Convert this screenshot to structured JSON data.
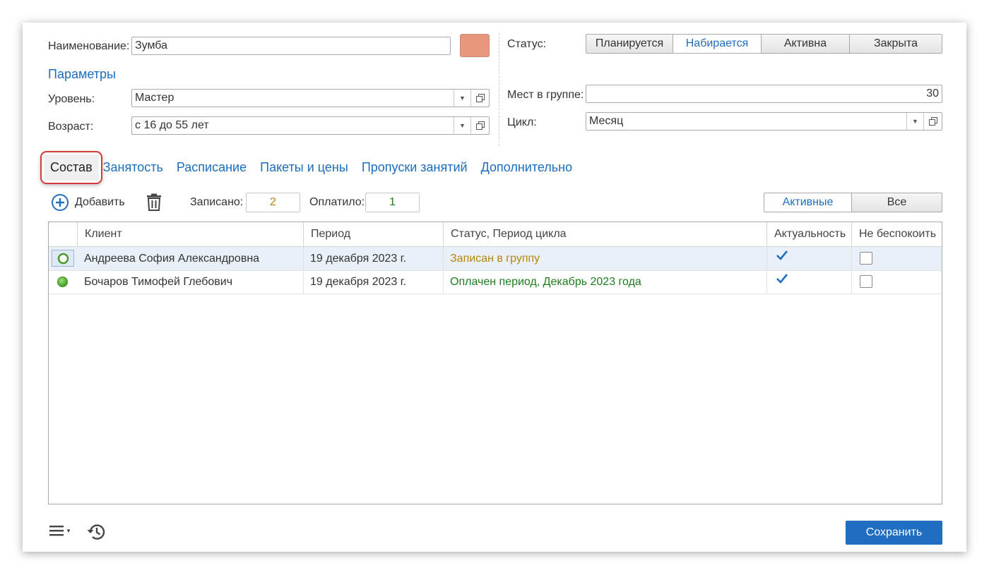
{
  "form": {
    "name_label": "Наименование:",
    "name_value": "Зумба",
    "color_swatch": "#e8967c",
    "params_title": "Параметры",
    "level_label": "Уровень:",
    "level_value": "Мастер",
    "age_label": "Возраст:",
    "age_value": "с 16 до 55 лет",
    "status_label": "Статус:",
    "status_options": [
      "Планируется",
      "Набирается",
      "Активна",
      "Закрыта"
    ],
    "status_selected": "Набирается",
    "seats_label": "Мест в группе:",
    "seats_value": "30",
    "cycle_label": "Цикл:",
    "cycle_value": "Месяц"
  },
  "tabs": [
    {
      "label": "Состав",
      "active": true
    },
    {
      "label": "Занятость"
    },
    {
      "label": "Расписание"
    },
    {
      "label": "Пакеты и цены"
    },
    {
      "label": "Пропуски занятий"
    },
    {
      "label": "Дополнительно"
    }
  ],
  "toolbar": {
    "add_label": "Добавить",
    "enrolled_label": "Записано:",
    "enrolled_value": "2",
    "paid_label": "Оплатило:",
    "paid_value": "1",
    "filter_options": [
      "Активные",
      "Все"
    ],
    "filter_selected": "Активные"
  },
  "table": {
    "columns": [
      "Клиент",
      "Период",
      "Статус, Период цикла",
      "Актуальность",
      "Не беспокоить"
    ],
    "rows": [
      {
        "client": "Андреева София Александровна",
        "period": "19 декабря 2023 г.",
        "status": "Записан в группу",
        "status_color": "#b8860b",
        "indicator": "outline",
        "actual": true,
        "no_disturb": false,
        "selected": true
      },
      {
        "client": "Бочаров Тимофей Глебович",
        "period": "19 декабря 2023 г.",
        "status": "Оплачен период, Декабрь 2023 года",
        "status_color": "#1e7d1e",
        "indicator": "filled",
        "actual": true,
        "no_disturb": false,
        "selected": false
      }
    ]
  },
  "footer": {
    "save_label": "Сохранить"
  },
  "colors": {
    "accent": "#1d6ebe",
    "enrolled": "#b8860b",
    "paid": "#1e7d1e",
    "save_bg": "#1f6ec2"
  }
}
